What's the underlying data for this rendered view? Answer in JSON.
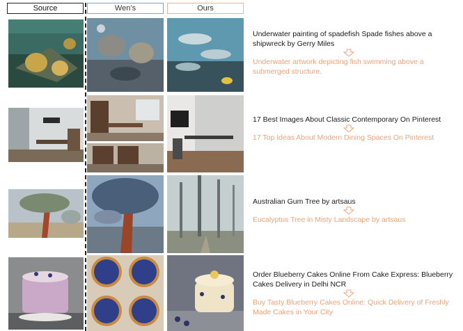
{
  "headers": {
    "source": "Source",
    "wens": "Wen’s",
    "ours": "Ours"
  },
  "colors": {
    "wens_border": "#7aa6d6",
    "ours_border": "#f2b08b",
    "rewrite_text": "#f0a27a"
  },
  "rows": [
    {
      "original": "Underwater painting of spadefish Spade fishes above a shipwreck by Gerry Miles",
      "rewritten": "Underwater artwork depicting fish swimming above a submerged structure."
    },
    {
      "original": "17 Best Images About Classic Contemporary On Pinterest",
      "rewritten": "17 Top Ideas About Modern Dining Spaces On Pinterest"
    },
    {
      "original": "Australian Gum Tree by artsaus",
      "rewritten": "Eucalyptus Tree in Misty Landscape by artsaus"
    },
    {
      "original": "Order Blueberry Cakes Online From Cake Express: Blueberry Cakes Delivery in Delhi NCR",
      "rewritten": "Buy Tasty Blueberry Cakes Online: Quick Delivery of Freshly Made Cakes in Your City"
    }
  ]
}
